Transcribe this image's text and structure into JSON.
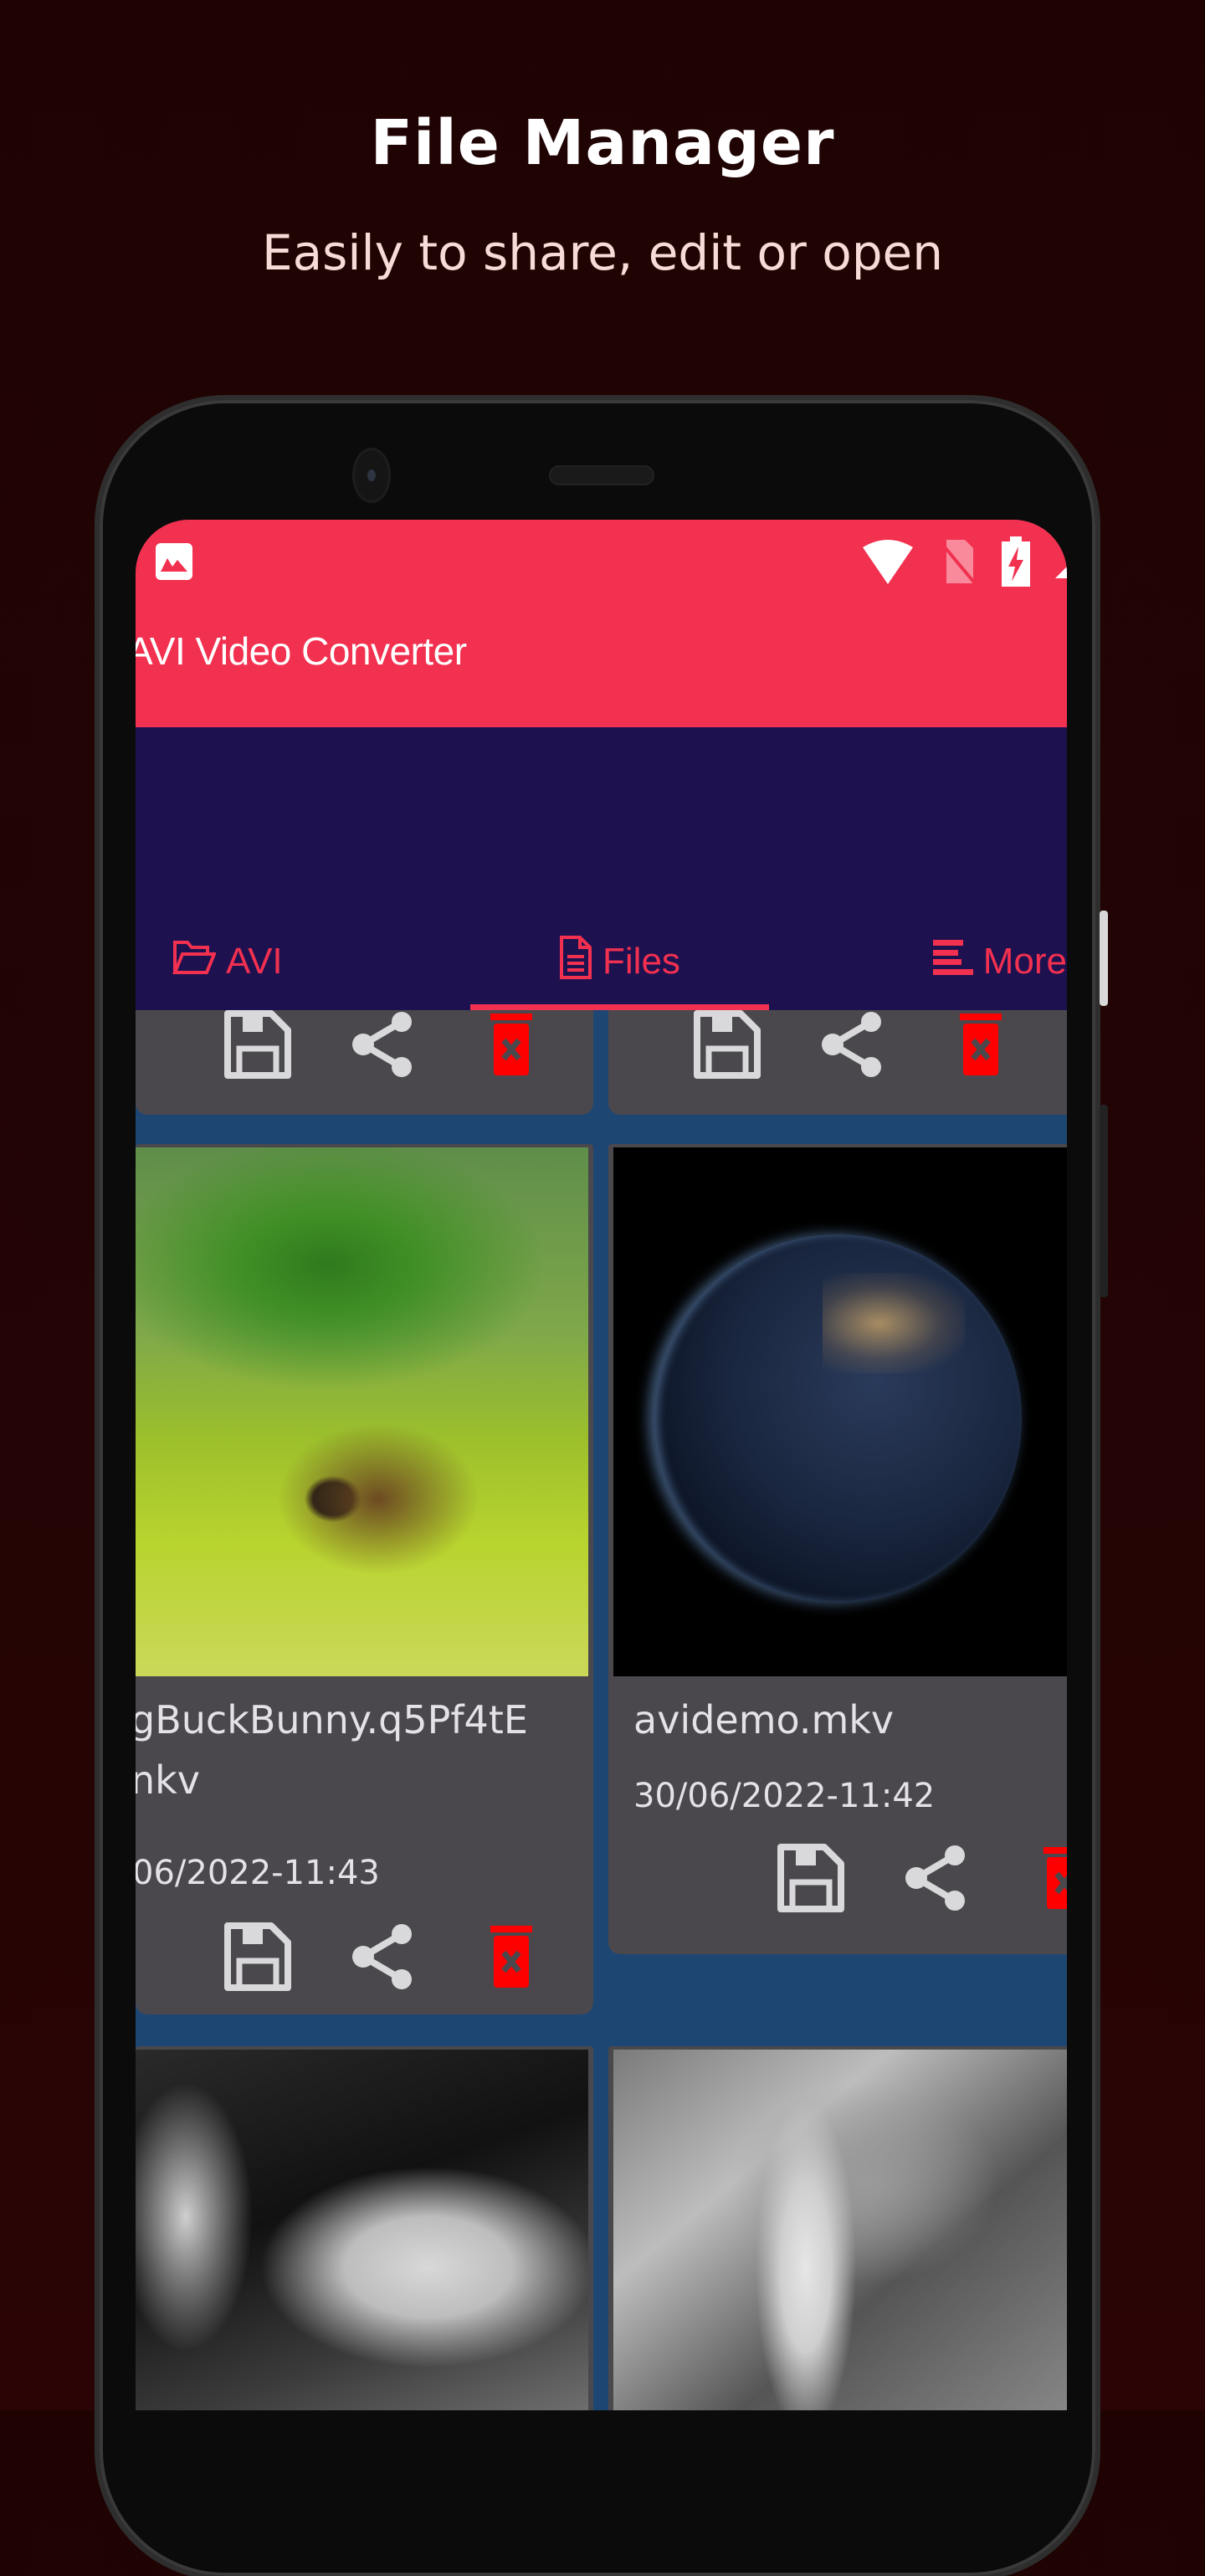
{
  "hero": {
    "title": "File Manager",
    "subtitle": "Easily to share, edit or open"
  },
  "status_bar": {
    "left_icon": "image-notification-icon",
    "right_icons": [
      "wifi-icon",
      "no-sim-icon",
      "battery-charging-icon"
    ]
  },
  "app": {
    "title": "AVI Video Converter",
    "colors": {
      "appbar": "#f2304f",
      "navy": "#1d1150",
      "grid_bg": "#1e4673",
      "card": "#4a484c",
      "delete": "#ff0000",
      "icon": "#d9d9dc"
    }
  },
  "tabs": [
    {
      "label": "AVI",
      "icon": "folder-open-icon",
      "active": false
    },
    {
      "label": "Files",
      "icon": "file-text-icon",
      "active": true
    },
    {
      "label": "More",
      "icon": "menu-lines-icon",
      "active": false
    }
  ],
  "files": [
    {
      "name": "",
      "date": "",
      "actions": [
        "save",
        "share",
        "delete"
      ]
    },
    {
      "name": "",
      "date": "",
      "actions": [
        "save",
        "share",
        "delete"
      ]
    },
    {
      "name": "gBuckBunny.q5Pf4tE\nnkv",
      "name_line1": "gBuckBunny.q5Pf4tE",
      "name_line2": "nkv",
      "date": "06/2022-11:43",
      "thumbnail": "tree-hill-scene",
      "actions": [
        "save",
        "share",
        "delete"
      ]
    },
    {
      "name": "avidemo.mkv",
      "date": "30/06/2022-11:42",
      "thumbnail": "earth-at-night",
      "actions": [
        "save",
        "share",
        "delete"
      ]
    },
    {
      "name": "",
      "date": "",
      "thumbnail": "grayscale-mechanical-closeup"
    },
    {
      "name": "",
      "date": "",
      "thumbnail": "grayscale-gear-assembly"
    }
  ],
  "actions": {
    "save": "Save",
    "share": "Share",
    "delete": "Delete"
  }
}
